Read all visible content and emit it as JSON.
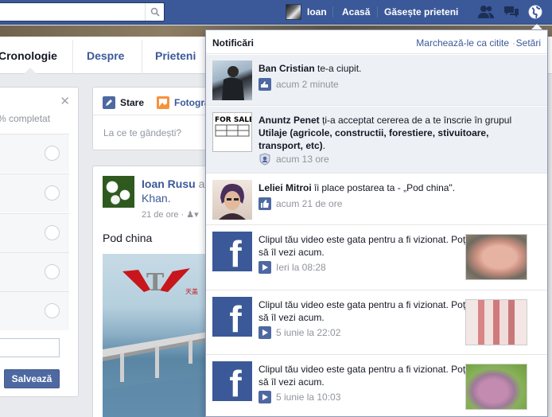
{
  "topbar": {
    "search_placeholder": "",
    "user_name": "Ioan",
    "home": "Acasă",
    "find_friends": "Găsește prieteni"
  },
  "timeline_nav": {
    "items": [
      "Cronologie",
      "Despre",
      "Prieteni"
    ]
  },
  "left_box": {
    "completed": "% completat",
    "save": "Salvează"
  },
  "composer": {
    "tab_status": "Stare",
    "tab_photo": "Fotogra",
    "placeholder": "La ce te gândești?"
  },
  "post": {
    "author": "Ioan Rusu",
    "author_rest": "a",
    "author_line2": "Khan.",
    "time": "21 de ore",
    "text": "Pod china"
  },
  "notifications": {
    "title": "Notificări",
    "mark_read": "Marchează-le ca citite",
    "separator": "·",
    "settings": "Setări",
    "items": [
      {
        "name": "Ban Cristian",
        "text": " te-a ciupit.",
        "time": "acum 2 minute",
        "icon": "poke-icon"
      },
      {
        "name": "Anuntz Penet",
        "text": " ți-a acceptat cererea de a te înscrie în grupul ",
        "group": "Utilaje (agricole, constructii, forestiere, stivuitoare, transport, etc)",
        "end": ".",
        "time": "acum 13 ore",
        "icon": "group-shield-icon"
      },
      {
        "name": "Leliei Mitroi",
        "text": " îi place postarea ta - „Pod china\".",
        "time": "acum 21 de ore",
        "icon": "like-icon"
      },
      {
        "text": "Clipul tău video este gata pentru a fi vizionat. Poți să îl vezi acum.",
        "time": "Ieri la 08:28",
        "icon": "video-icon"
      },
      {
        "text": "Clipul tău video este gata pentru a fi vizionat. Poți să îl vezi acum.",
        "time": "5 iunie la 22:02",
        "icon": "video-icon"
      },
      {
        "text": "Clipul tău video este gata pentru a fi vizionat. Poți să îl vezi acum.",
        "time": "5 iunie la 10:03",
        "icon": "video-icon"
      }
    ]
  },
  "colors": {
    "brand_blue": "#3b5998",
    "unread_bg": "#edf0f5"
  }
}
